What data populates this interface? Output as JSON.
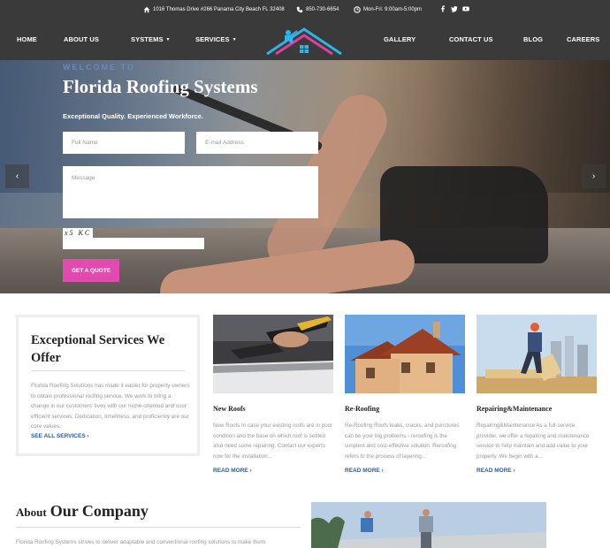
{
  "topbar": {
    "address": "1016 Thomas Drive #266 Panama City Beach FL 32408",
    "phone": "850-730-6654",
    "hours": "Mon-Fri: 9:00am-5:00pm",
    "social": [
      "facebook-icon",
      "twitter-icon",
      "youtube-icon"
    ]
  },
  "nav": {
    "left": [
      "HOME",
      "ABOUT US",
      "SYSTEMS",
      "SERVICES"
    ],
    "right": [
      "GALLERY",
      "CONTACT US",
      "BLOG",
      "CAREERS"
    ]
  },
  "hero": {
    "welcome": "WELCOME TO",
    "title": "Florida Roofing Systems",
    "tagline": "Exceptional Quality. Experienced Workforce.",
    "full_name_placeholder": "Full Name",
    "email_placeholder": "E-mail Address",
    "message_placeholder": "Message",
    "captcha": "x5 KC",
    "cta": "GET A QUOTE",
    "prev": "‹",
    "next": "›"
  },
  "services": {
    "heading": "Exceptional Services We Offer",
    "body": "Florida Roofing Solutions has made it easier for property owners to obtain professional roofing service. We work to bring a change in our customers' lives with our niche-oriented and cost efficient services. Dedication, timeliness, and proficiency are our core values.",
    "see_all": "SEE ALL SERVICES",
    "cards": [
      {
        "title": "New Roofs",
        "text": "New Roofs   In case your existing roofs are in poor condition and the base on which roof is settled also need some repairing. Contact our experts now for the installation...",
        "more": "READ MORE"
      },
      {
        "title": "Re-Roofing",
        "text": "Re-Roofing Roofs leaks, cracks, and punctures can be your big problems - reroofing is the simplest and cost-effective solution. Reroofing refers to the process of layering...",
        "more": "READ MORE"
      },
      {
        "title": "Repairing&Maintenance",
        "text": "Repairing&Maintenance   As a full-service provider, we offer a repairing and maintenance service to help maintain and add value to your property. We begin with a...",
        "more": "READ MORE"
      }
    ]
  },
  "about": {
    "heading_small": "About",
    "heading_large": "Our Company",
    "body": "Florida Roofing Systems strives to deliver adaptable and conventional roofing solutions to make them"
  },
  "colors": {
    "bar_bg": "#3a3a3a",
    "accent_pink": "#e14bb0",
    "link_blue": "#2a5ca0",
    "logo_cyan": "#2eb4e6",
    "logo_magenta": "#e43ca3"
  }
}
